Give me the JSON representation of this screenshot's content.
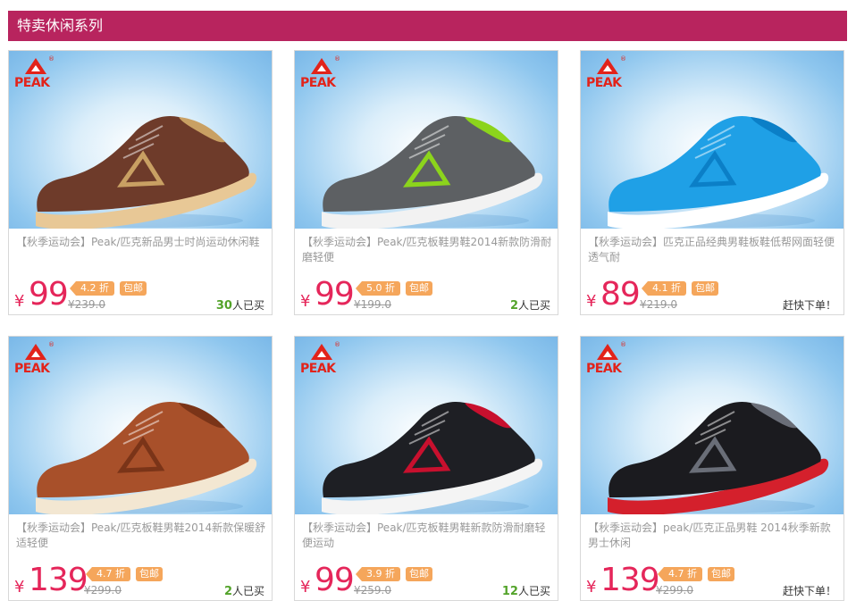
{
  "header": {
    "title": "特卖休闲系列"
  },
  "brand": {
    "logo_text": "PEAK",
    "logo_reg": "®",
    "color": "#e2231a"
  },
  "colors": {
    "accent": "#b8245e",
    "price": "#e5265a",
    "badge": "#f5a65b",
    "sold_count": "#53a32a"
  },
  "products": [
    {
      "title": "【秋季运动会】Peak/匹克新品男士时尚运动休闲鞋",
      "currency": "¥",
      "price": "99",
      "discount": "4.2 折",
      "free_label": "包邮",
      "original_price": "¥239.0",
      "sold_num": "30",
      "sold_suffix": "人已买",
      "shoe_color": "#6e3b2a",
      "sole_color": "#e8c896",
      "accent_color": "#c9a063"
    },
    {
      "title": "【秋季运动会】Peak/匹克板鞋男鞋2014新款防滑耐磨轻便",
      "currency": "¥",
      "price": "99",
      "discount": "5.0 折",
      "free_label": "包邮",
      "original_price": "¥199.0",
      "sold_num": "2",
      "sold_suffix": "人已买",
      "shoe_color": "#5d6063",
      "sole_color": "#f2f2f2",
      "accent_color": "#8cd41c"
    },
    {
      "title": "【秋季运动会】匹克正品经典男鞋板鞋低帮网面轻便透气耐",
      "currency": "¥",
      "price": "89",
      "discount": "4.1 折",
      "free_label": "包邮",
      "original_price": "¥219.0",
      "sold_num": "",
      "sold_suffix": "赶快下单！",
      "shoe_color": "#1fa0e6",
      "sole_color": "#ffffff",
      "accent_color": "#0b7fc7"
    },
    {
      "title": "【秋季运动会】Peak/匹克板鞋男鞋2014新款保暖舒适轻便",
      "currency": "¥",
      "price": "139",
      "discount": "4.7 折",
      "free_label": "包邮",
      "original_price": "¥299.0",
      "sold_num": "2",
      "sold_suffix": "人已买",
      "shoe_color": "#a8502a",
      "sole_color": "#f3e7d2",
      "accent_color": "#7a3418"
    },
    {
      "title": "【秋季运动会】Peak/匹克板鞋男鞋新款防滑耐磨轻便运动",
      "currency": "¥",
      "price": "99",
      "discount": "3.9 折",
      "free_label": "包邮",
      "original_price": "¥259.0",
      "sold_num": "12",
      "sold_suffix": "人已买",
      "shoe_color": "#1e1f24",
      "sole_color": "#f4f4f4",
      "accent_color": "#c8102e"
    },
    {
      "title": "【秋季运动会】peak/匹克正品男鞋 2014秋季新款男士休闲",
      "currency": "¥",
      "price": "139",
      "discount": "4.7 折",
      "free_label": "包邮",
      "original_price": "¥299.0",
      "sold_num": "",
      "sold_suffix": "赶快下单！",
      "shoe_color": "#1b1b1f",
      "sole_color": "#d4202c",
      "accent_color": "#6a6e78"
    }
  ]
}
